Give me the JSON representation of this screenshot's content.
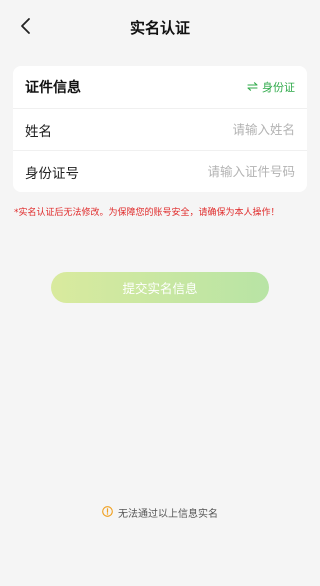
{
  "header": {
    "title": "实名认证",
    "back_icon": "chevron-left-icon"
  },
  "card": {
    "section_title": "证件信息",
    "switch_label": "身份证",
    "switch_icon": "swap-arrows-icon",
    "name_label": "姓名",
    "name_placeholder": "请输入姓名",
    "name_value": "",
    "id_label": "身份证号",
    "id_placeholder": "请输入证件号码",
    "id_value": ""
  },
  "warning_text": "*实名认证后无法修改。为保障您的账号安全，请确保为本人操作！",
  "submit_label": "提交实名信息",
  "help": {
    "icon": "warning-circle-icon",
    "text": "无法通过以上信息实名"
  },
  "colors": {
    "accent_green": "#2faa4a",
    "warning_red": "#e02a2a",
    "button_gradient_start": "#d9ea9e",
    "button_gradient_end": "#b8e4a5",
    "help_icon_orange": "#f0a020"
  }
}
